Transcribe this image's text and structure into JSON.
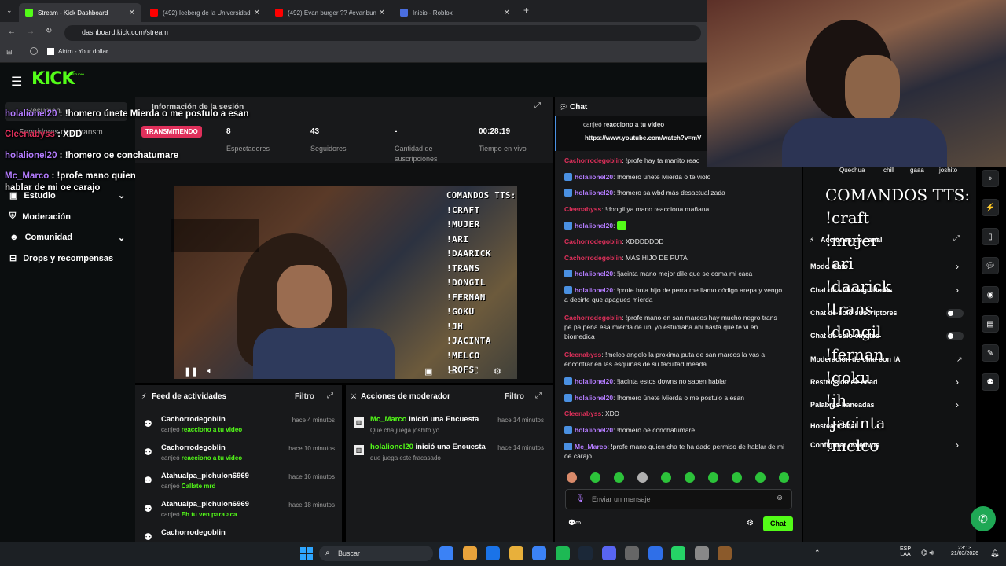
{
  "browser": {
    "tabs": [
      {
        "label": "Stream - Kick Dashboard",
        "color": "#53fc18"
      },
      {
        "label": "(492) Iceberg de la Universidad",
        "color": "#ff0000"
      },
      {
        "label": "(492) Evan burger ?? #evanbun",
        "color": "#ff0000"
      },
      {
        "label": "Inicio - Roblox",
        "color": "#4a6ee0"
      }
    ],
    "url": "dashboard.kick.com/stream",
    "bookmark": "Airtm - Your dollar..."
  },
  "kick": {
    "logo": "KICK",
    "logo_sup": "STUDIO"
  },
  "sidebar": {
    "items": [
      "Estudio",
      "Moderación",
      "Comunidad",
      "Drops y recompensas"
    ],
    "partial": [
      "Resumen",
      "Seguidores de retransm"
    ]
  },
  "session": {
    "title": "Información de la sesión",
    "status": "TRANSMITIENDO",
    "stats": [
      {
        "value": "8",
        "label": "Espectadores"
      },
      {
        "value": "43",
        "label": "Seguidores"
      },
      {
        "value": "-",
        "label": "Cantidad de suscripciones"
      },
      {
        "value": "00:28:19",
        "label": "Tiempo en vivo"
      }
    ]
  },
  "overlay_chat": [
    {
      "user": "holalionel20",
      "msg": " : !homero únete Mierda o me postulo a esan",
      "color": "#b47cff"
    },
    {
      "user": "Cleenabyss",
      "msg": " : XDD",
      "color": "#e0305b"
    },
    {
      "user": "holalionel20",
      "msg": " : !homero oe conchatumare",
      "color": "#b47cff"
    },
    {
      "user": "Mc_Marco",
      "msg": " : !profe mano quien cha te ha dado permiso de hablar de mi oe carajo",
      "color": "#b47cff"
    }
  ],
  "tts": {
    "title": "COMANDOS TTS:",
    "commands": [
      "!CRAFT",
      "!MUJER",
      "!ARI",
      "!DAARICK",
      "!TRANS",
      "!DONGIL",
      "!FERNAN",
      "!GOKU",
      "!JH",
      "!JACINTA",
      "!MELCO",
      "!ROFS"
    ],
    "big": [
      "COMANDOS TTS:",
      "!craft",
      "!mujer",
      "!ari",
      "!daarick",
      "!trans",
      "!dongil",
      "!fernan",
      "!goku",
      "!jh",
      "!jacinta",
      "!melco"
    ]
  },
  "feed": {
    "title": "Feed de actividades",
    "filter": "Filtro",
    "items": [
      {
        "name": "Cachorrodegoblin",
        "pre": "canjeó ",
        "reward": "reacciono a tu video",
        "time": "hace 4 minutos"
      },
      {
        "name": "Cachorrodegoblin",
        "pre": "canjeó ",
        "reward": "reacciono a tu video",
        "time": "hace 10 minutos"
      },
      {
        "name": "Atahualpa_pichulon6969",
        "pre": "canjeó ",
        "reward": "Callate mrd",
        "time": "hace 16 minutos"
      },
      {
        "name": "Atahualpa_pichulon6969",
        "pre": "canjeó ",
        "reward": "Eh tu ven para aca",
        "time": "hace 18 minutos"
      },
      {
        "name": "Cachorrodegoblin",
        "pre": "",
        "reward": "",
        "time": ""
      }
    ]
  },
  "mod": {
    "title": "Acciones de moderador",
    "filter": "Filtro",
    "items": [
      {
        "name": "Mc_Marco",
        "action": " inició una Encuesta",
        "sub": "Que cha juega joshito yo",
        "time": "hace 14 minutos"
      },
      {
        "name": "holalionel20",
        "action": " inició una Encuesta",
        "sub": "que juega este fracasado",
        "time": "hace 14 minutos"
      }
    ]
  },
  "chat": {
    "title": "Chat",
    "pinned_pre": "canjeó ",
    "pinned_reward": "reacciono a tu video",
    "pinned_link": "https://www.youtube.com/watch?v=mV",
    "messages": [
      {
        "user": "Cachorrodegoblin",
        "text": ": !profe hay ta manito reac",
        "cls": "u-red",
        "badge": false
      },
      {
        "user": "holalionel20",
        "text": ": !homero únete Mierda o te violo",
        "cls": "u-purple",
        "badge": true
      },
      {
        "user": "holalionel20",
        "text": ": !homero sa wbd más desactualizada",
        "cls": "u-purple",
        "badge": true
      },
      {
        "user": "Cleenabyss",
        "text": ": !dongil ya mano reacciona mañana",
        "cls": "u-red",
        "badge": false
      },
      {
        "user": "holalionel20",
        "text": ": ",
        "cls": "u-purple",
        "badge": true
      },
      {
        "user": "Cachorrodegoblin",
        "text": ": XDDDDDDD",
        "cls": "u-red",
        "badge": false
      },
      {
        "user": "Cachorrodegoblin",
        "text": ": MAS HIJO DE PUTA",
        "cls": "u-red",
        "badge": false
      },
      {
        "user": "holalionel20",
        "text": ": !jacinta mano mejor dile que se coma mi caca",
        "cls": "u-purple",
        "badge": true
      },
      {
        "user": "holalionel20",
        "text": ": !profe hola hijo de perra me llamo código arepa y vengo a decirte que apagues mierda",
        "cls": "u-purple",
        "badge": true
      },
      {
        "user": "Cachorrodegoblin",
        "text": ": !profe mano en san marcos hay mucho negro trans pe pa pena esa mierda de uni yo estudiaba ahi hasta que te vi en biomedica",
        "cls": "u-red",
        "badge": false
      },
      {
        "user": "Cleenabyss",
        "text": ": !melco angelo la proxima puta de san marcos la vas a encontrar en las esquinas de su facultad meada",
        "cls": "u-red",
        "badge": false
      },
      {
        "user": "holalionel20",
        "text": ": !jacinta estos downs no saben hablar",
        "cls": "u-purple",
        "badge": true
      },
      {
        "user": "holalionel20",
        "text": ": !homero únete Mierda o me postulo a esan",
        "cls": "u-purple",
        "badge": true
      },
      {
        "user": "Cleenabyss",
        "text": ": XDD",
        "cls": "u-red",
        "badge": false
      },
      {
        "user": "holalionel20",
        "text": ": !homero oe conchatumare",
        "cls": "u-purple",
        "badge": true
      },
      {
        "user": "Mc_Marco",
        "text": ": !profe mano quien cha te ha dado permiso de hablar de mi oe carajo",
        "cls": "u-purple",
        "badge": true
      }
    ],
    "placeholder": "Enviar un mensaje",
    "send": "Chat"
  },
  "actions": {
    "title": "Acciones de canal",
    "rows": [
      {
        "label": "Modo lento",
        "ctrl": "chev"
      },
      {
        "label": "Chat de solo seguidores",
        "ctrl": "chev"
      },
      {
        "label": "Chat de solo suscriptores",
        "ctrl": "toggle"
      },
      {
        "label": "Chat de solo emotes",
        "ctrl": "toggle"
      },
      {
        "label": "Moderación de chat con IA",
        "ctrl": "ext"
      },
      {
        "label": "Restricción de edad",
        "ctrl": "chev"
      },
      {
        "label": "Palabras baneadas",
        "ctrl": "chev"
      },
      {
        "label": "Hostear canal",
        "ctrl": "none"
      },
      {
        "label": "Configurar objetivos",
        "ctrl": "chev"
      }
    ],
    "emotes": [
      "Quechua",
      "chill",
      "gaaa",
      "joshito"
    ]
  },
  "taskbar": {
    "search": "Buscar",
    "lang": "ESP",
    "lang2": "LAA",
    "time": "23:13",
    "date": "21/03/2026"
  }
}
